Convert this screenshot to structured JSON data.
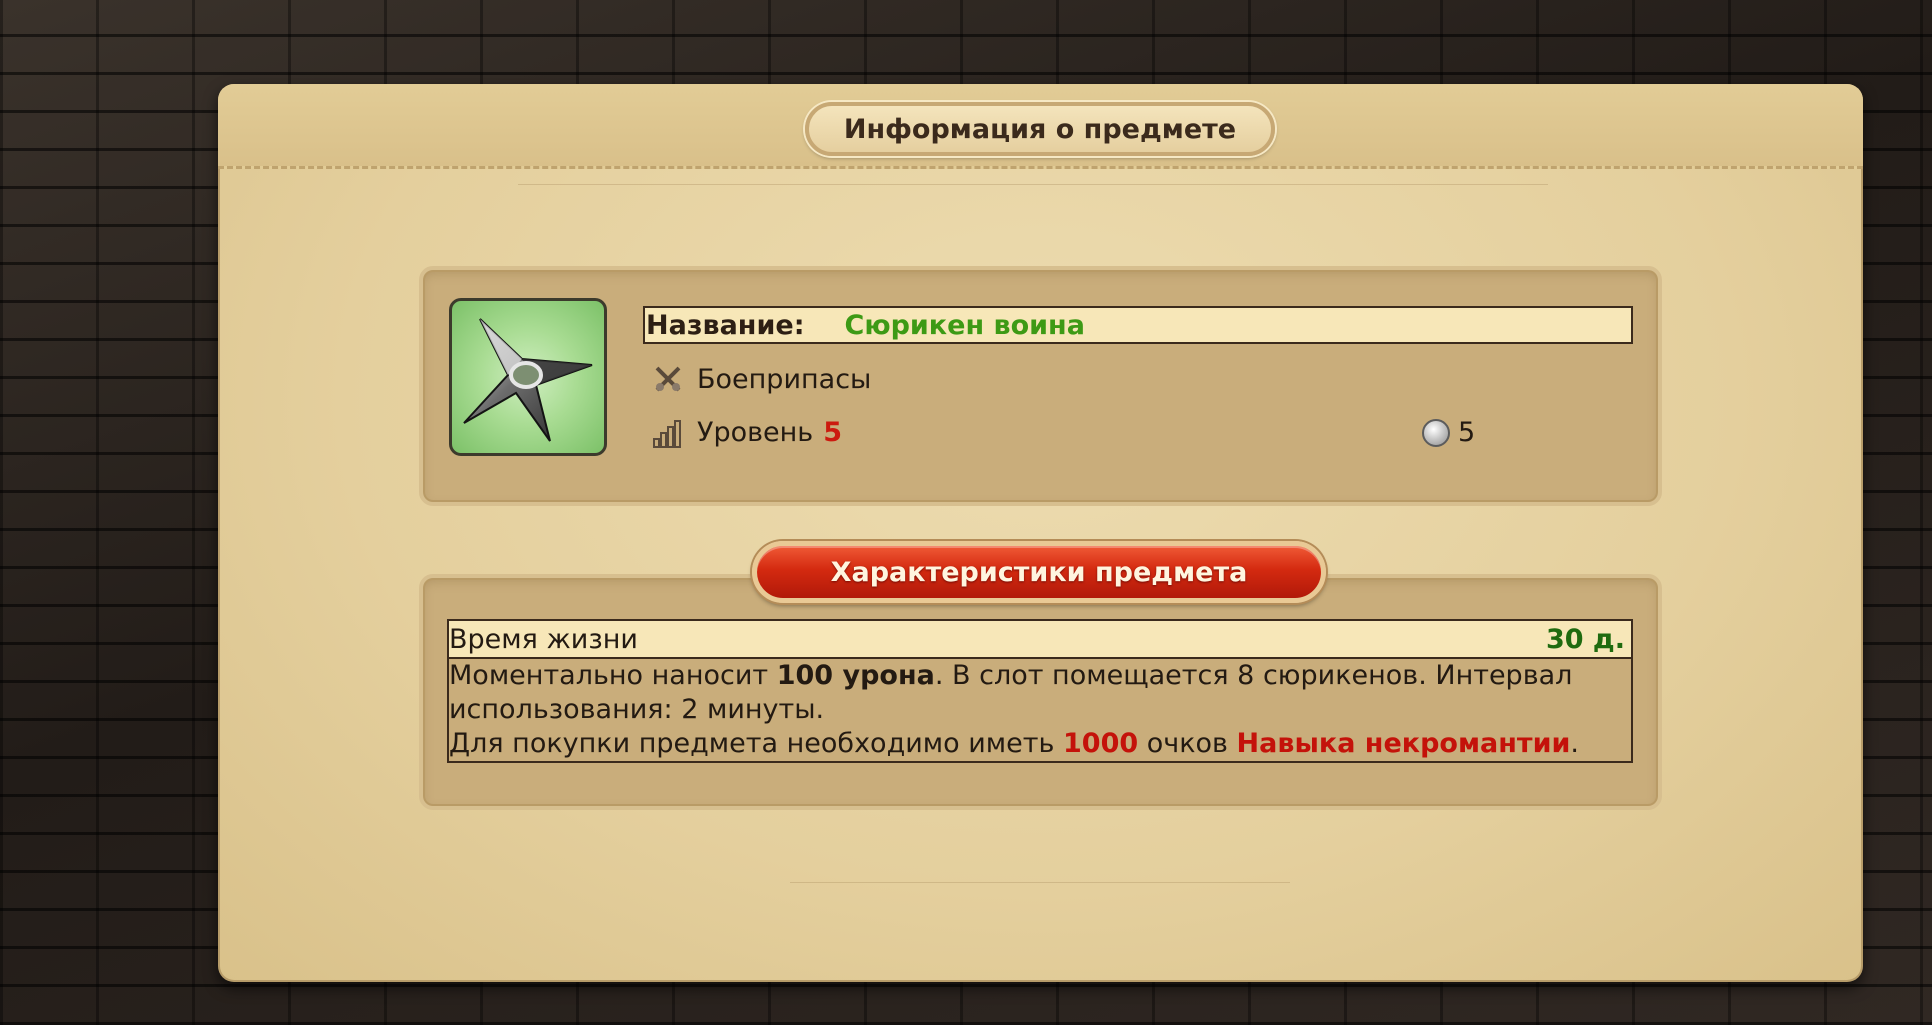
{
  "panel": {
    "title": "Информация о предмете"
  },
  "item": {
    "name_label": "Название:",
    "name_value": "Сюрикен воина",
    "type": "Боеприпасы",
    "level_label": "Уровень",
    "level_value": "5",
    "cost": "5",
    "image_icon": "shuriken-icon"
  },
  "characteristics": {
    "button_label": "Характеристики предмета",
    "lifetime_label": "Время жизни",
    "lifetime_value": "30 д.",
    "desc_part1": "Моментально наносит ",
    "desc_bold": "100 урона",
    "desc_part2": ". В слот помещается 8 сюрикенов. Интервал использования: 2 минуты.",
    "req_part1": "Для покупки предмета необходимо иметь ",
    "req_points": "1000",
    "req_part2": " очков ",
    "req_skill": "Навыка некромантии",
    "req_end": "."
  },
  "colors": {
    "name_value": "#3d9a15",
    "level_value": "#cc1a0f",
    "lifetime_value": "#1f6b0f",
    "requirement": "#c4120a",
    "button": "#d42a10"
  }
}
